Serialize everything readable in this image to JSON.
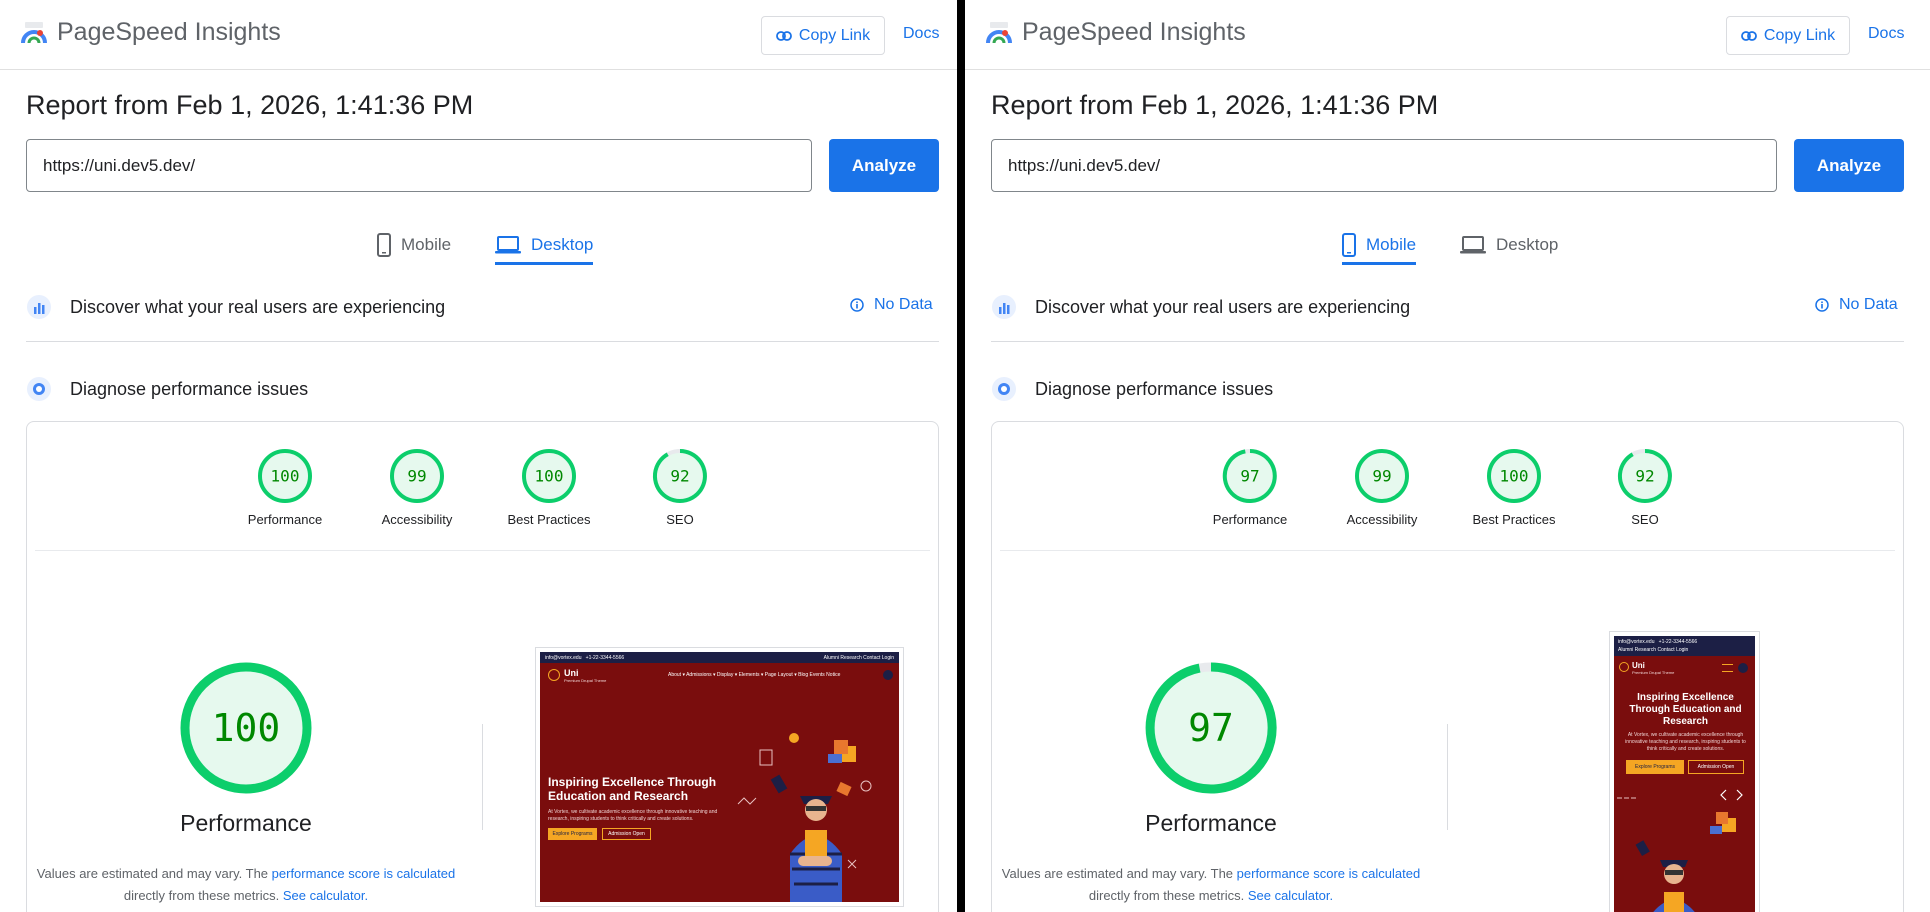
{
  "left": {
    "app_title": "PageSpeed Insights",
    "copy_link_label": "Copy Link",
    "docs_label": "Docs",
    "report_title": "Report from Feb 1, 2026, 1:41:36 PM",
    "url_value": "https://uni.dev5.dev/",
    "analyze_label": "Analyze",
    "tabs": [
      {
        "label": "Mobile",
        "active": false
      },
      {
        "label": "Desktop",
        "active": true
      }
    ],
    "discover_title": "Discover what your real users are experiencing",
    "no_data_label": "No Data",
    "diagnose_title": "Diagnose performance issues",
    "scores": [
      {
        "label": "Performance",
        "value": 100
      },
      {
        "label": "Accessibility",
        "value": 99
      },
      {
        "label": "Best Practices",
        "value": 100
      },
      {
        "label": "SEO",
        "value": 92
      }
    ],
    "main_score": 100,
    "main_label": "Performance",
    "note_prefix": "Values are estimated and may vary. The",
    "note_link1": "performance score is calculated",
    "note_mid": "directly from these metrics.",
    "note_link2": "See calculator.",
    "site": {
      "email": "info@vortex.edu",
      "phone": "+1-22-3344-5566",
      "top_links": "Alumni  Research  Contact  Login",
      "brand": "Uni",
      "tagline": "Premium Drupal Theme",
      "nav": "About ▾  Admissions ▾  Display ▾  Elements ▾  Page Layout ▾  Blog  Events  Notice",
      "hero_title": "Inspiring Excellence Through Education and Research",
      "hero_text": "At Vortex, we cultivate academic excellence through innovative teaching and research, inspiring students to think critically and create solutions.",
      "btn_primary": "Explore Programs",
      "btn_secondary": "Admission Open"
    }
  },
  "right": {
    "app_title": "PageSpeed Insights",
    "copy_link_label": "Copy Link",
    "docs_label": "Docs",
    "report_title": "Report from Feb 1, 2026, 1:41:36 PM",
    "url_value": "https://uni.dev5.dev/",
    "analyze_label": "Analyze",
    "tabs": [
      {
        "label": "Mobile",
        "active": true
      },
      {
        "label": "Desktop",
        "active": false
      }
    ],
    "discover_title": "Discover what your real users are experiencing",
    "no_data_label": "No Data",
    "diagnose_title": "Diagnose performance issues",
    "scores": [
      {
        "label": "Performance",
        "value": 97
      },
      {
        "label": "Accessibility",
        "value": 99
      },
      {
        "label": "Best Practices",
        "value": 100
      },
      {
        "label": "SEO",
        "value": 92
      }
    ],
    "main_score": 97,
    "main_label": "Performance",
    "note_prefix": "Values are estimated and may vary. The",
    "note_link1": "performance score is calculated",
    "note_mid": "directly from these metrics.",
    "note_link2": "See calculator.",
    "site": {
      "email": "info@vortex.edu",
      "phone": "+1-22-3344-5566",
      "top_links": "Alumni  Research  Contact  Login",
      "brand": "Uni",
      "tagline": "Premium Drupal Theme",
      "hero_title": "Inspiring Excellence Through Education and Research",
      "hero_text": "At Vortex, we cultivate academic excellence through innovative teaching and research, inspiring students to think critically and create solutions.",
      "btn_primary": "Explore Programs",
      "btn_secondary": "Admission Open"
    }
  },
  "colors": {
    "accent": "#1a73e8",
    "pass_green": "#0cce6b",
    "pass_bg": "#e6f9ee",
    "pass_text": "#008800",
    "site_red": "#7a0d0d",
    "site_navy": "#1c1f45",
    "site_orange": "#f5a623"
  },
  "icons": {
    "logo": "pagespeed-logo-icon",
    "link": "link-icon",
    "mobile": "smartphone-icon",
    "desktop": "laptop-icon",
    "field_data": "field-data-icon",
    "lab_data": "lab-data-icon",
    "info": "info-icon"
  }
}
